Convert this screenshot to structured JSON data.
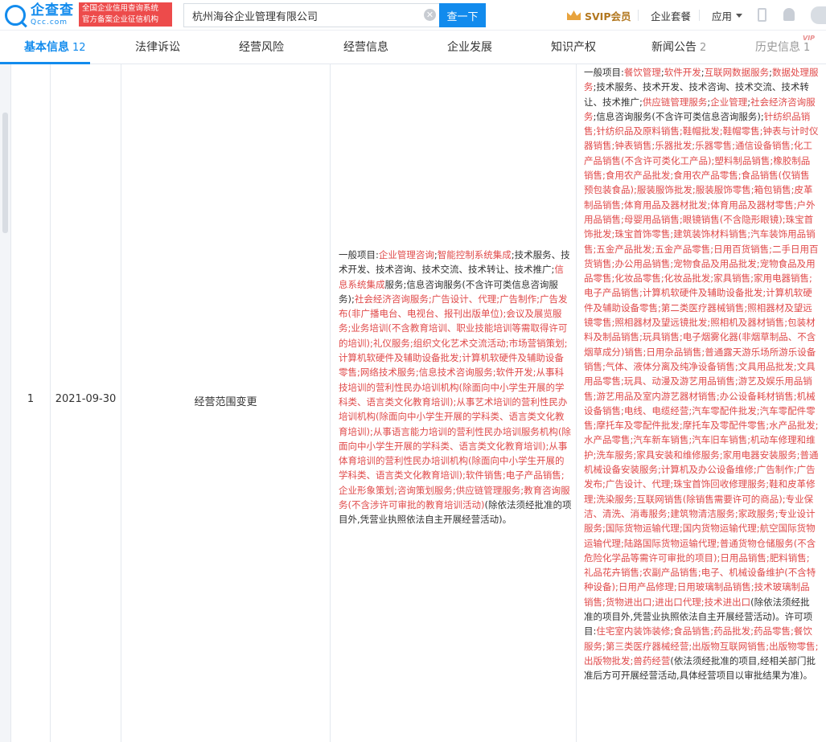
{
  "header": {
    "logo_cn": "企查查",
    "logo_en": "Qcc.com",
    "badge_line1": "全国企业信用查询系统",
    "badge_line2": "官方备案企业征信机构",
    "search_value": "杭州海谷企业管理有限公司",
    "search_button": "查一下",
    "svip": "SVIP会员",
    "package": "企业套餐",
    "app": "应用",
    "accent_color": "#128bed"
  },
  "tabs": [
    {
      "label": "基本信息",
      "count": "12"
    },
    {
      "label": "法律诉讼",
      "count": ""
    },
    {
      "label": "经营风险",
      "count": ""
    },
    {
      "label": "经营信息",
      "count": ""
    },
    {
      "label": "企业发展",
      "count": ""
    },
    {
      "label": "知识产权",
      "count": ""
    },
    {
      "label": "新闻公告",
      "count": "2"
    },
    {
      "label": "历史信息",
      "count": "1"
    }
  ],
  "vip_tag": "VIP",
  "record": {
    "index": "1",
    "date": "2021-09-30",
    "item": "经营范围变更",
    "before": [
      {
        "t": "一般项目:",
        "h": false
      },
      {
        "t": "企业管理咨询",
        "h": true
      },
      {
        "t": ";",
        "h": false
      },
      {
        "t": "智能控制系统集成",
        "h": true
      },
      {
        "t": ";技术服务、技术开发、技术咨询、技术交流、技术转让、技术推广;",
        "h": false
      },
      {
        "t": "信息系统集成",
        "h": true
      },
      {
        "t": "服务;信息咨询服务(不含许可类信息咨询服务);",
        "h": false
      },
      {
        "t": "社会经济咨询服务",
        "h": true
      },
      {
        "t": ";广告设计、代理;广告制作;广告发布(非广播电台、电视台、报刊出版单位);会议及展览服务;业务培训(不含教育培训、职业技能培训等需取得许可的培训);礼仪服务;组织文化艺术交流活动;市场营销策划;计算机软硬件及辅助设备批发;计算机软硬件及辅助设备零售;网络技术服务;信息技术咨询服务;软件开发;从事科技培训的营利性民办培训机构(除面向中小学生开展的学科类、语言类文化教育培训);从事艺术培训的营利性民办培训机构(除面向中小学生开展的学科类、语言类文化教育培训);从事语言能力培训的营利性民办培训服务机构(除面向中小学生开展的学科类、语言类文化教育培训);从事体育培训的营利性民办培训机构(除面向中小学生开展的学科类、语言类文化教育培训);软件销售;电子产品销售;企业形象策划;咨询策划服务;供应链管理服务;教育咨询服务(不含涉许可审批的教育培训活动)",
        "h": true
      },
      {
        "t": "(除依法须经批准的项目外,凭营业执照依法自主开展经营活动)。",
        "h": false
      }
    ],
    "after": [
      {
        "t": "一般项目:",
        "h": false
      },
      {
        "t": "餐饮管理",
        "h": true
      },
      {
        "t": ";",
        "h": false
      },
      {
        "t": "软件开发",
        "h": true
      },
      {
        "t": ";",
        "h": false
      },
      {
        "t": "互联网数据服务",
        "h": true
      },
      {
        "t": ";",
        "h": false
      },
      {
        "t": "数据处理服务",
        "h": true
      },
      {
        "t": ";技术服务、技术开发、技术咨询、技术交流、技术转让、技术推广;",
        "h": false
      },
      {
        "t": "供应链管理服务",
        "h": true
      },
      {
        "t": ";",
        "h": false
      },
      {
        "t": "企业管理",
        "h": true
      },
      {
        "t": ";",
        "h": false
      },
      {
        "t": "社会经济咨询服务",
        "h": true
      },
      {
        "t": ";信息咨询服务(不含许可类信息咨询服务);",
        "h": false
      },
      {
        "t": "针纺织品销售;针纺织品及原料销售;鞋帽批发;鞋帽零售;钟表与计时仪器销售;钟表销售;乐器批发;乐器零售;通信设备销售;化工产品销售(不含许可类化工产品);塑料制品销售;橡胶制品销售;食用农产品批发;食用农产品零售;食品销售(仅销售预包装食品);服装服饰批发;服装服饰零售;箱包销售;皮革制品销售;体育用品及器材批发;体育用品及器材零售;户外用品销售;母婴用品销售;眼镜销售(不含隐形眼镜);珠宝首饰批发;珠宝首饰零售;建筑装饰材料销售;汽车装饰用品销售;五金产品批发;五金产品零售;日用百货销售;二手日用百货销售;办公用品销售;宠物食品及用品批发;宠物食品及用品零售;化妆品零售;化妆品批发;家具销售;家用电器销售;电子产品销售;计算机软硬件及辅助设备批发;计算机软硬件及辅助设备零售;第二类医疗器械销售;照相器材及望远镜零售;照相器材及望远镜批发;照相机及器材销售;包装材料及制品销售;玩具销售;电子烟雾化器(非烟草制品、不含烟草成分)销售;日用杂品销售;普通露天游乐场所游乐设备销售;气体、液体分离及纯净设备销售;文具用品批发;文具用品零售;玩具、动漫及游艺用品销售;游艺及娱乐用品销售;游艺用品及室内游艺器材销售;办公设备耗材销售;机械设备销售;电线、电缆经营;汽车零配件批发;汽车零配件零售;摩托车及零配件批发;摩托车及零配件零售;水产品批发;水产品零售;汽车新车销售;汽车旧车销售;机动车修理和维护;洗车服务;家具安装和维修服务;家用电器安装服务;普通机械设备安装服务;计算机及办公设备维修;广告制作;广告发布;广告设计、代理;珠宝首饰回收修理服务;鞋和皮革修理;洗染服务;互联网销售(除销售需要许可的商品);专业保洁、清洗、消毒服务;建筑物清洁服务;家政服务;专业设计服务;国际货物运输代理;国内货物运输代理;航空国际货物运输代理;陆路国际货物运输代理;普通货物仓储服务(不含危险化学品等需许可审批的项目);日用品销售;肥料销售;礼品花卉销售;农副产品销售;电子、机械设备维护(不含特种设备);日用产品修理;日用玻璃制品销售;技术玻璃制品销售;货物进出口;进出口代理;技术进出口",
        "h": true
      },
      {
        "t": "(除依法须经批准的项目外,凭营业执照依法自主开展经营活动)。许可项目:",
        "h": false
      },
      {
        "t": "住宅室内装饰装修;食品销售;药品批发;药品零售;餐饮服务;第三类医疗器械经营;出版物互联网销售;出版物零售;出版物批发;兽药经营",
        "h": true
      },
      {
        "t": "(依法须经批准的项目,经相关部门批准后方可开展经营活动,具体经营项目以审批结果为准)。",
        "h": false
      }
    ]
  }
}
